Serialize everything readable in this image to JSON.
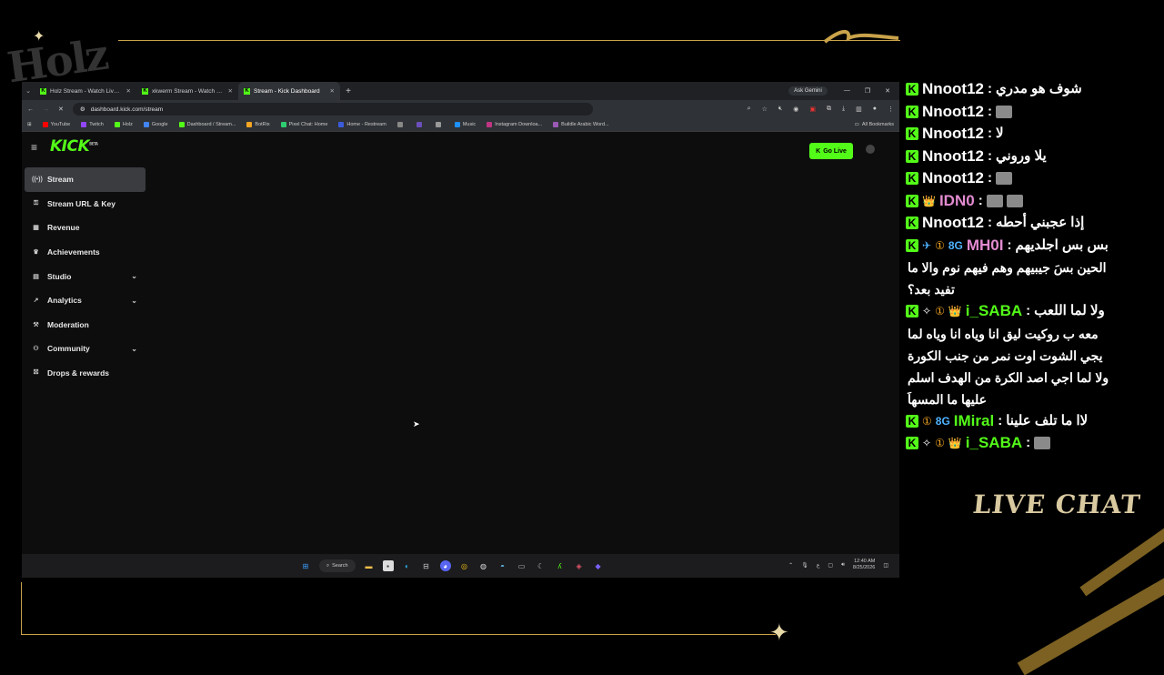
{
  "overlay": {
    "logo_text": "Holz",
    "live_chat_title": "LIVE CHAT",
    "accent_color": "#c9a24a"
  },
  "browser": {
    "tabs": [
      {
        "title": "Holz Stream - Watch Live on Kick"
      },
      {
        "title": "xkwerm Stream - Watch Live on Kick"
      },
      {
        "title": "Stream - Kick Dashboard"
      }
    ],
    "ask_gemini": "Ask Gemini",
    "url": "dashboard.kick.com/stream",
    "bookmarks": [
      {
        "label": "YouTube",
        "color": "#ff0000"
      },
      {
        "label": "Twitch",
        "color": "#9146ff"
      },
      {
        "label": "Holz",
        "color": "#53fc18"
      },
      {
        "label": "Google",
        "color": "#4285f4"
      },
      {
        "label": "Dashboard / Stream...",
        "color": "#53fc18"
      },
      {
        "label": "BotRix",
        "color": "#f5a623"
      },
      {
        "label": "Pixel Chat: Home",
        "color": "#2ecc71"
      },
      {
        "label": "Home - Restream",
        "color": "#3b5bdb"
      },
      {
        "label": "",
        "color": "#888888"
      },
      {
        "label": "",
        "color": "#6b4fbb"
      },
      {
        "label": "",
        "color": "#999999"
      },
      {
        "label": "Music",
        "color": "#1e90ff"
      },
      {
        "label": "Instagram Downloa...",
        "color": "#c13584"
      },
      {
        "label": "Buildle Arabic Word...",
        "color": "#9b59b6"
      }
    ],
    "all_bookmarks": "All Bookmarks"
  },
  "kick": {
    "logo": "KICK",
    "logo_tag": "BETA",
    "go_live": "Go Live",
    "brand_color": "#53fc18",
    "sidebar": [
      {
        "label": "Stream",
        "icon": "broadcast-icon",
        "glyph": "((•))",
        "active": true,
        "chevron": false
      },
      {
        "label": "Stream URL & Key",
        "icon": "key-icon",
        "glyph": "⚿",
        "active": false,
        "chevron": false
      },
      {
        "label": "Revenue",
        "icon": "revenue-icon",
        "glyph": "▦",
        "active": false,
        "chevron": false
      },
      {
        "label": "Achievements",
        "icon": "trophy-icon",
        "glyph": "♛",
        "active": false,
        "chevron": false
      },
      {
        "label": "Studio",
        "icon": "studio-icon",
        "glyph": "▤",
        "active": false,
        "chevron": true
      },
      {
        "label": "Analytics",
        "icon": "analytics-icon",
        "glyph": "↗",
        "active": false,
        "chevron": true
      },
      {
        "label": "Moderation",
        "icon": "hammer-icon",
        "glyph": "⚒",
        "active": false,
        "chevron": false
      },
      {
        "label": "Community",
        "icon": "community-icon",
        "glyph": "⚇",
        "active": false,
        "chevron": true
      },
      {
        "label": "Drops & rewards",
        "icon": "gift-icon",
        "glyph": "⛝",
        "active": false,
        "chevron": false
      }
    ]
  },
  "taskbar": {
    "search": "Search",
    "time": "12:40 AM",
    "date": "8/25/2026",
    "lang": "ع"
  },
  "chat": [
    {
      "user": "Nnoot12",
      "user_color": "#ffffff",
      "badges": [],
      "text": "شوف هو مدري",
      "emotes": 0,
      "cont": []
    },
    {
      "user": "Nnoot12",
      "user_color": "#ffffff",
      "badges": [],
      "text": "",
      "emotes": 1,
      "cont": []
    },
    {
      "user": "Nnoot12",
      "user_color": "#ffffff",
      "badges": [],
      "text": "لا",
      "emotes": 0,
      "cont": []
    },
    {
      "user": "Nnoot12",
      "user_color": "#ffffff",
      "badges": [],
      "text": "يلا وروني",
      "emotes": 0,
      "cont": []
    },
    {
      "user": "Nnoot12",
      "user_color": "#ffffff",
      "badges": [],
      "text": "",
      "emotes": 1,
      "cont": []
    },
    {
      "user": "IDN0",
      "user_color": "#e38bd0",
      "badges": [
        "👑"
      ],
      "text": "",
      "emotes": 2,
      "cont": []
    },
    {
      "user": "Nnoot12",
      "user_color": "#ffffff",
      "badges": [],
      "text": "إذا عجبني أحطه",
      "emotes": 0,
      "cont": []
    },
    {
      "user": "MH0I",
      "user_color": "#e38bd0",
      "badges": [
        "✈",
        "①",
        "8G"
      ],
      "text": "بس بس اجلديهم",
      "emotes": 0,
      "cont": [
        "الحين بسَ جيبيهم وهم فيهم نوم والا ما",
        "تفيد بعد؟"
      ]
    },
    {
      "user": "i_SABA",
      "user_color": "#53fc18",
      "badges": [
        "✧",
        "①",
        "👑"
      ],
      "text": "ولا لما اللعب",
      "emotes": 0,
      "cont": [
        "معه ب روكيت ليق انا وياه انا وياه لما",
        "يجي الشوت اوت نمر من جنب الكورة",
        "ولا لما اجي اصد الكرة من الهدف اسلم",
        "عليها ما المسهاَ"
      ]
    },
    {
      "user": "IMiral",
      "user_color": "#53fc18",
      "badges": [
        "①",
        "8G"
      ],
      "text": "لاا ما تلف علينا",
      "emotes": 0,
      "cont": []
    },
    {
      "user": "i_SABA",
      "user_color": "#53fc18",
      "badges": [
        "✧",
        "①",
        "👑"
      ],
      "text": "",
      "emotes": 1,
      "cont": []
    }
  ]
}
